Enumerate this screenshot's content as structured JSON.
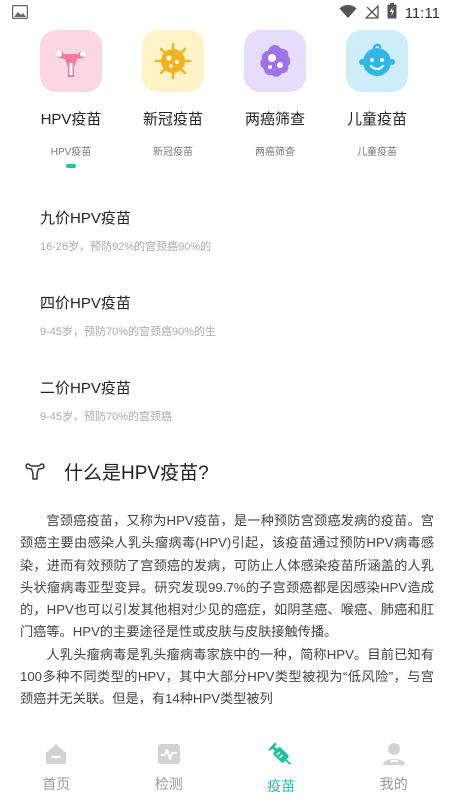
{
  "status_bar": {
    "time": "11:11"
  },
  "categories": [
    {
      "title": "HPV疫苗",
      "subtitle": "HPV疫苗",
      "icon": "uterus-icon",
      "bg": "#fbd7e3",
      "active": true
    },
    {
      "title": "新冠疫苗",
      "subtitle": "新冠疫苗",
      "icon": "virus-icon",
      "bg": "#fdf3c6",
      "active": false
    },
    {
      "title": "两癌筛查",
      "subtitle": "两癌筛查",
      "icon": "cell-icon",
      "bg": "#e6dcfb",
      "active": false
    },
    {
      "title": "儿童疫苗",
      "subtitle": "儿童疫苗",
      "icon": "baby-face-icon",
      "bg": "#cdeef9",
      "active": false
    }
  ],
  "vaccines": [
    {
      "title": "九价HPV疫苗",
      "desc": "16-26岁，预防92%的宫颈癌90%的"
    },
    {
      "title": "四价HPV疫苗",
      "desc": "9-45岁，预防70%的宫颈癌90%的生"
    },
    {
      "title": "二价HPV疫苗",
      "desc": "9-45岁，预防70%的宫颈癌"
    }
  ],
  "article": {
    "title": "什么是HPV疫苗?",
    "paragraphs": [
      "宫颈癌疫苗，又称为HPV疫苗，是一种预防宫颈癌发病的疫苗。宫颈癌主要由感染人乳头瘤病毒(HPV)引起，该疫苗通过预防HPV病毒感染，进而有效预防了宫颈癌的发病，可防止人体感染疫苗所涵盖的人乳头状瘤病毒亚型变异。研究发现99.7%的子宫颈癌都是因感染HPV造成的，HPV也可以引发其他相对少见的癌症，如阴茎癌、喉癌、肺癌和肛门癌等。HPV的主要途径是性或皮肤与皮肤接触传播。",
      "人乳头瘤病毒是乳头瘤病毒家族中的一种，简称HPV。目前已知有100多种不同类型的HPV，其中大部分HPV类型被视为“低风险”，与宫颈癌并无关联。但是，有14种HPV类型被列"
    ]
  },
  "bottom_nav": [
    {
      "label": "首页",
      "icon": "home-icon",
      "active": false
    },
    {
      "label": "检测",
      "icon": "monitor-icon",
      "active": false
    },
    {
      "label": "疫苗",
      "icon": "syringe-icon",
      "active": true
    },
    {
      "label": "我的",
      "icon": "user-icon",
      "active": false
    }
  ],
  "colors": {
    "accent": "#1fc3a0",
    "icon_gray": "#cfcfcf"
  }
}
